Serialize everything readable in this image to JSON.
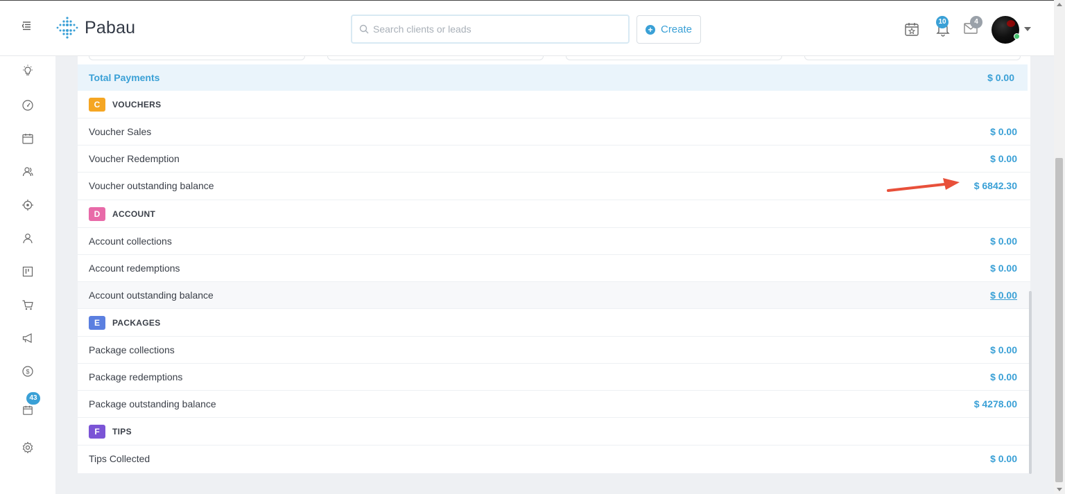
{
  "header": {
    "app_name": "Pabau",
    "search_placeholder": "Search clients or leads",
    "create_label": "Create",
    "notifications_count": "10",
    "messages_count": "4"
  },
  "sidebar": {
    "items": [
      {
        "name": "sidebar-item-ideas",
        "icon": "lightbulb-icon"
      },
      {
        "name": "sidebar-item-dashboard",
        "icon": "speedometer-icon"
      },
      {
        "name": "sidebar-item-calendar",
        "icon": "calendar-icon"
      },
      {
        "name": "sidebar-item-clients",
        "icon": "users-icon"
      },
      {
        "name": "sidebar-item-leads",
        "icon": "target-icon"
      },
      {
        "name": "sidebar-item-staff",
        "icon": "user-icon"
      },
      {
        "name": "sidebar-item-board",
        "icon": "kanban-icon"
      },
      {
        "name": "sidebar-item-shop",
        "icon": "cart-icon"
      },
      {
        "name": "sidebar-item-marketing",
        "icon": "megaphone-icon"
      },
      {
        "name": "sidebar-item-financials",
        "icon": "dollar-icon"
      },
      {
        "name": "sidebar-item-tasks",
        "icon": "calendar-check-icon"
      },
      {
        "name": "sidebar-item-settings",
        "icon": "gear-icon"
      }
    ],
    "tasks_badge": "43"
  },
  "report": {
    "total_payments": {
      "label": "Total Payments",
      "value": "$ 0.00"
    },
    "sections": [
      {
        "letter": "C",
        "title": "VOUCHERS",
        "color": "#f5a623",
        "rows": [
          {
            "label": "Voucher Sales",
            "value": "$ 0.00"
          },
          {
            "label": "Voucher Redemption",
            "value": "$ 0.00"
          },
          {
            "label": "Voucher outstanding balance",
            "value": "$ 6842.30"
          }
        ]
      },
      {
        "letter": "D",
        "title": "ACCOUNT",
        "color": "#e86aa8",
        "rows": [
          {
            "label": "Account collections",
            "value": "$ 0.00"
          },
          {
            "label": "Account redemptions",
            "value": "$ 0.00"
          },
          {
            "label": "Account outstanding balance",
            "value": "$ 0.00"
          }
        ]
      },
      {
        "letter": "E",
        "title": "PACKAGES",
        "color": "#5b7fe0",
        "rows": [
          {
            "label": "Package collections",
            "value": "$ 0.00"
          },
          {
            "label": "Package redemptions",
            "value": "$ 0.00"
          },
          {
            "label": "Package outstanding balance",
            "value": "$ 4278.00"
          }
        ]
      },
      {
        "letter": "F",
        "title": "TIPS",
        "color": "#7b54d6",
        "rows": [
          {
            "label": "Tips Collected",
            "value": "$ 0.00"
          }
        ]
      }
    ]
  },
  "colors": {
    "accent": "#3aa0d6",
    "annotation_arrow": "#e8503a"
  }
}
